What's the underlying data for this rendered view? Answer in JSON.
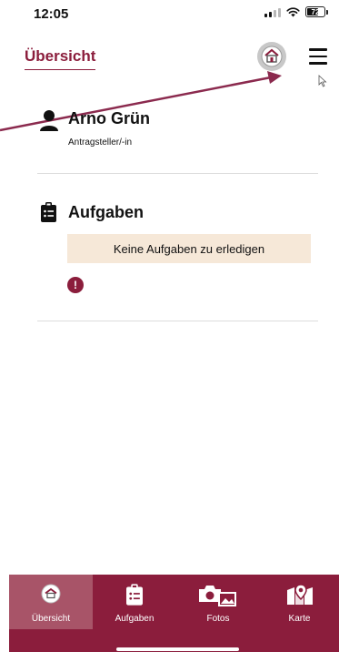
{
  "status_bar": {
    "time": "12:05",
    "battery": "72",
    "battery_level_percent": 72,
    "icons": [
      "signal-icon",
      "wifi-icon",
      "battery-icon"
    ]
  },
  "header": {
    "title": "Übersicht",
    "logo_icon": "app-logo-icon",
    "menu_icon": "hamburger-menu-icon"
  },
  "applicant": {
    "name": "Arno Grün",
    "role": "Antragsteller/-in",
    "icon": "person-icon"
  },
  "tasks": {
    "heading": "Aufgaben",
    "icon": "clipboard-list-icon",
    "empty_message": "Keine Aufgaben zu erledigen",
    "alert_icon": "exclamation-circle-icon"
  },
  "bottom_nav": {
    "items": [
      {
        "label": "Übersicht",
        "icon": "app-logo-icon",
        "active": true
      },
      {
        "label": "Aufgaben",
        "icon": "clipboard-list-icon",
        "active": false
      },
      {
        "label": "Fotos",
        "icon": "camera-gallery-icon",
        "active": false
      },
      {
        "label": "Karte",
        "icon": "map-pin-icon",
        "active": false
      }
    ]
  },
  "colors": {
    "brand": "#8b1d3c",
    "active_nav": "#a85468",
    "notice_background": "#f6e8d8",
    "annotation_arrow": "#8b2a4e"
  }
}
